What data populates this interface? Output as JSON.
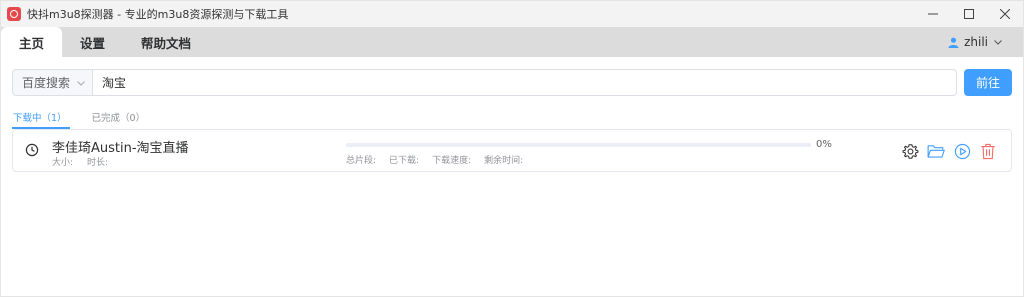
{
  "window": {
    "title": "快抖m3u8探测器 - 专业的m3u8资源探测与下载工具"
  },
  "tabs": [
    {
      "label": "主页",
      "active": true
    },
    {
      "label": "设置",
      "active": false
    },
    {
      "label": "帮助文档",
      "active": false
    }
  ],
  "user": {
    "name": "zhili"
  },
  "search": {
    "engine": "百度搜索",
    "query": "淘宝",
    "button": "前往"
  },
  "status_tabs": {
    "downloading": "下载中（1）",
    "completed": "已完成（0）"
  },
  "task": {
    "name": "李佳琦Austin-淘宝直播",
    "size_label": "大小:",
    "duration_label": "时长:",
    "progress": 0,
    "percent_text": "0%",
    "segments_label": "总片段:",
    "downloaded_label": "已下载:",
    "speed_label": "下载速度:",
    "remaining_label": "剩余时间:"
  },
  "colors": {
    "accent": "#409eff",
    "danger": "#f56c6c",
    "icon": "#303133"
  }
}
